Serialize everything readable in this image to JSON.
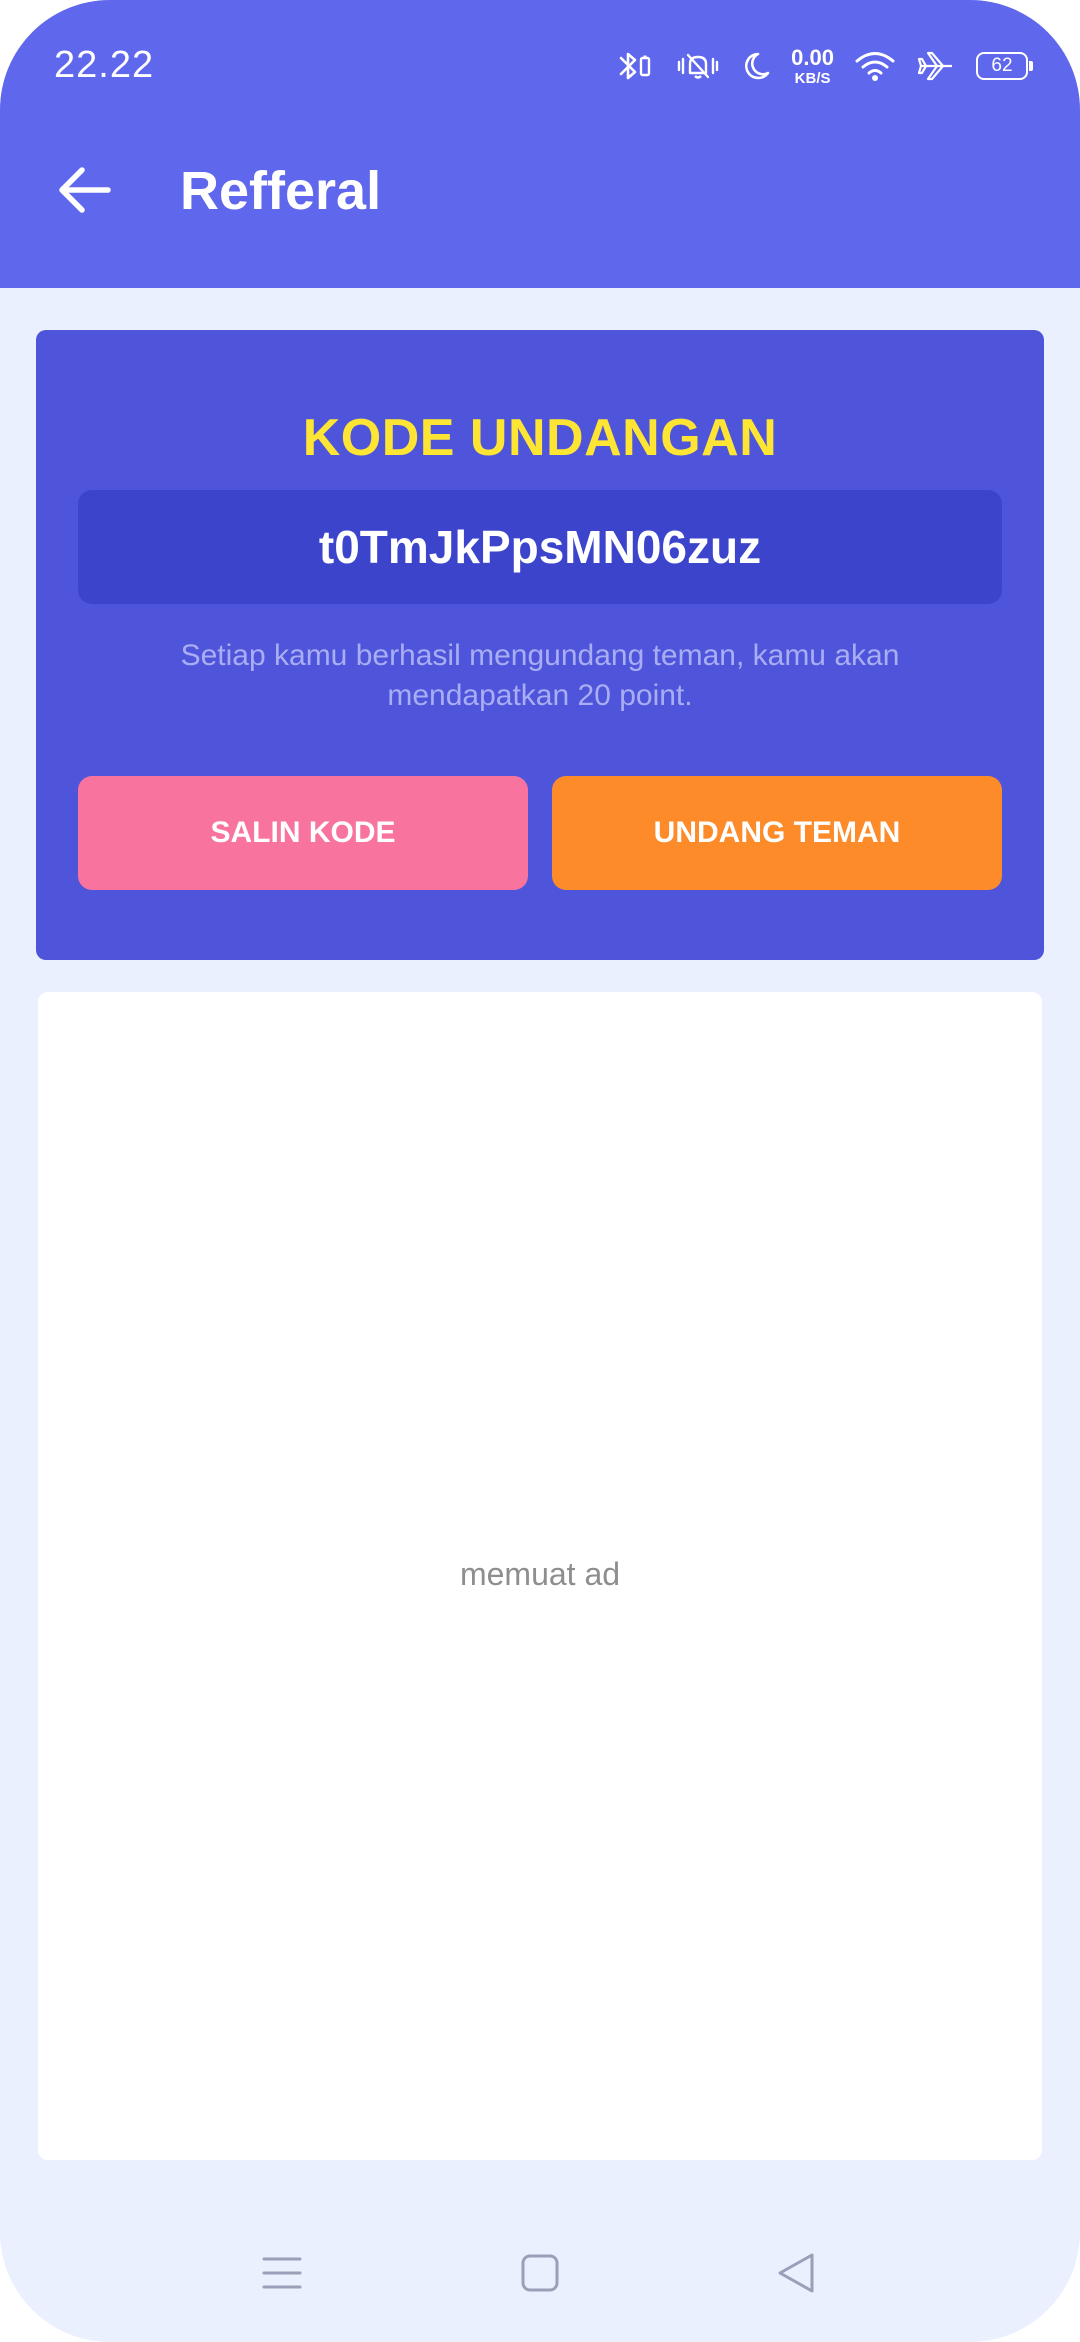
{
  "status_bar": {
    "time": "22.22",
    "net_speed_value": "0.00",
    "net_speed_unit": "KB/S",
    "battery": "62",
    "icons": [
      "bluetooth-icon",
      "vibrate-icon",
      "moon-icon",
      "wifi-icon",
      "airplane-icon",
      "battery-icon"
    ]
  },
  "appbar": {
    "back_icon": "arrow-left-icon",
    "title": "Refferal"
  },
  "referral_card": {
    "heading": "KODE UNDANGAN",
    "code": "t0TmJkPpsMN06zuz",
    "description": "Setiap kamu berhasil mengundang teman, kamu akan mendapatkan 20 point.",
    "copy_button": "SALIN KODE",
    "invite_button": "UNDANG TEMAN"
  },
  "ad": {
    "loading_text": "memuat ad"
  },
  "nav_bar": {
    "icons": [
      "menu-icon",
      "home-icon",
      "back-icon"
    ]
  },
  "colors": {
    "appbar": "#5f67ec",
    "card": "#4e55db",
    "code_box": "#3b44cb",
    "heading": "#ffe533",
    "copy_button": "#f8749f",
    "invite_button": "#fd8b2a",
    "background": "#ebf0ff"
  }
}
